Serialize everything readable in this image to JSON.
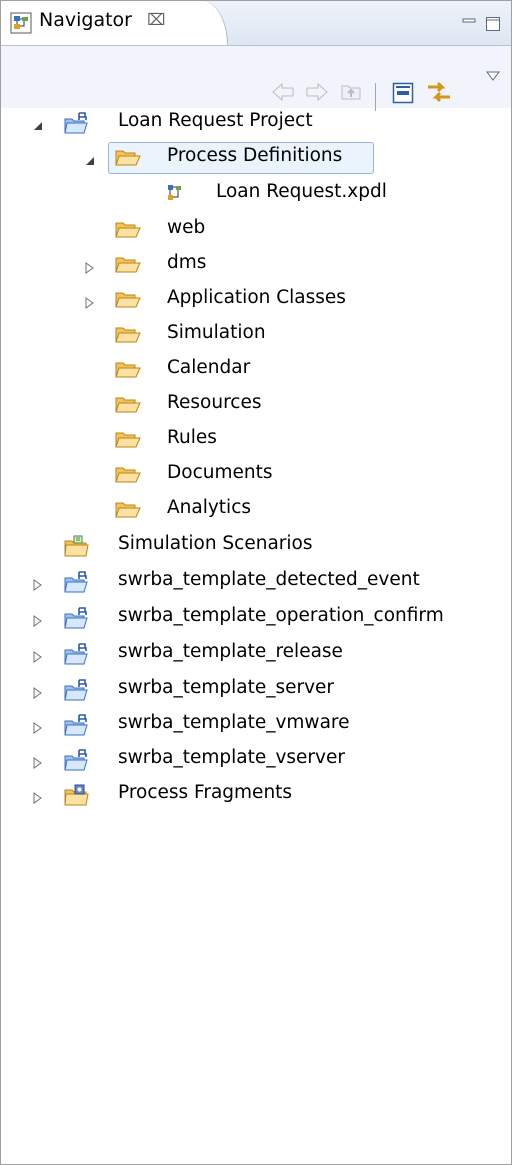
{
  "view": {
    "title": "Navigator",
    "close_glyph": "⌧"
  },
  "toolbar": {
    "back": "back-arrow-icon",
    "forward": "forward-arrow-icon",
    "up": "go-into-icon",
    "collapse_all": "collapse-all-icon",
    "link_editor": "link-with-editor-icon",
    "menu": "view-menu-icon"
  },
  "tree": {
    "project": "Loan Request Project",
    "process_definitions": "Process Definitions",
    "loan_request_xpdl": "Loan Request.xpdl",
    "web": "web",
    "dms": "dms",
    "application_classes": "Application Classes",
    "simulation": "Simulation",
    "calendar": "Calendar",
    "resources": "Resources",
    "rules": "Rules",
    "documents": "Documents",
    "analytics": "Analytics",
    "simulation_scenarios": "Simulation Scenarios",
    "tpl_detected_event": "swrba_template_detected_event",
    "tpl_operation_confirm": "swrba_template_operation_confirm",
    "tpl_release": "swrba_template_release",
    "tpl_server": "swrba_template_server",
    "tpl_vmware": "swrba_template_vmware",
    "tpl_vserver": "swrba_template_vserver",
    "process_fragments": "Process Fragments"
  },
  "colors": {
    "selection_bg": "#ebf3fd",
    "selection_border": "#92b5e4",
    "folder": "#f5c25a",
    "project_blue": "#3a6fc4"
  }
}
